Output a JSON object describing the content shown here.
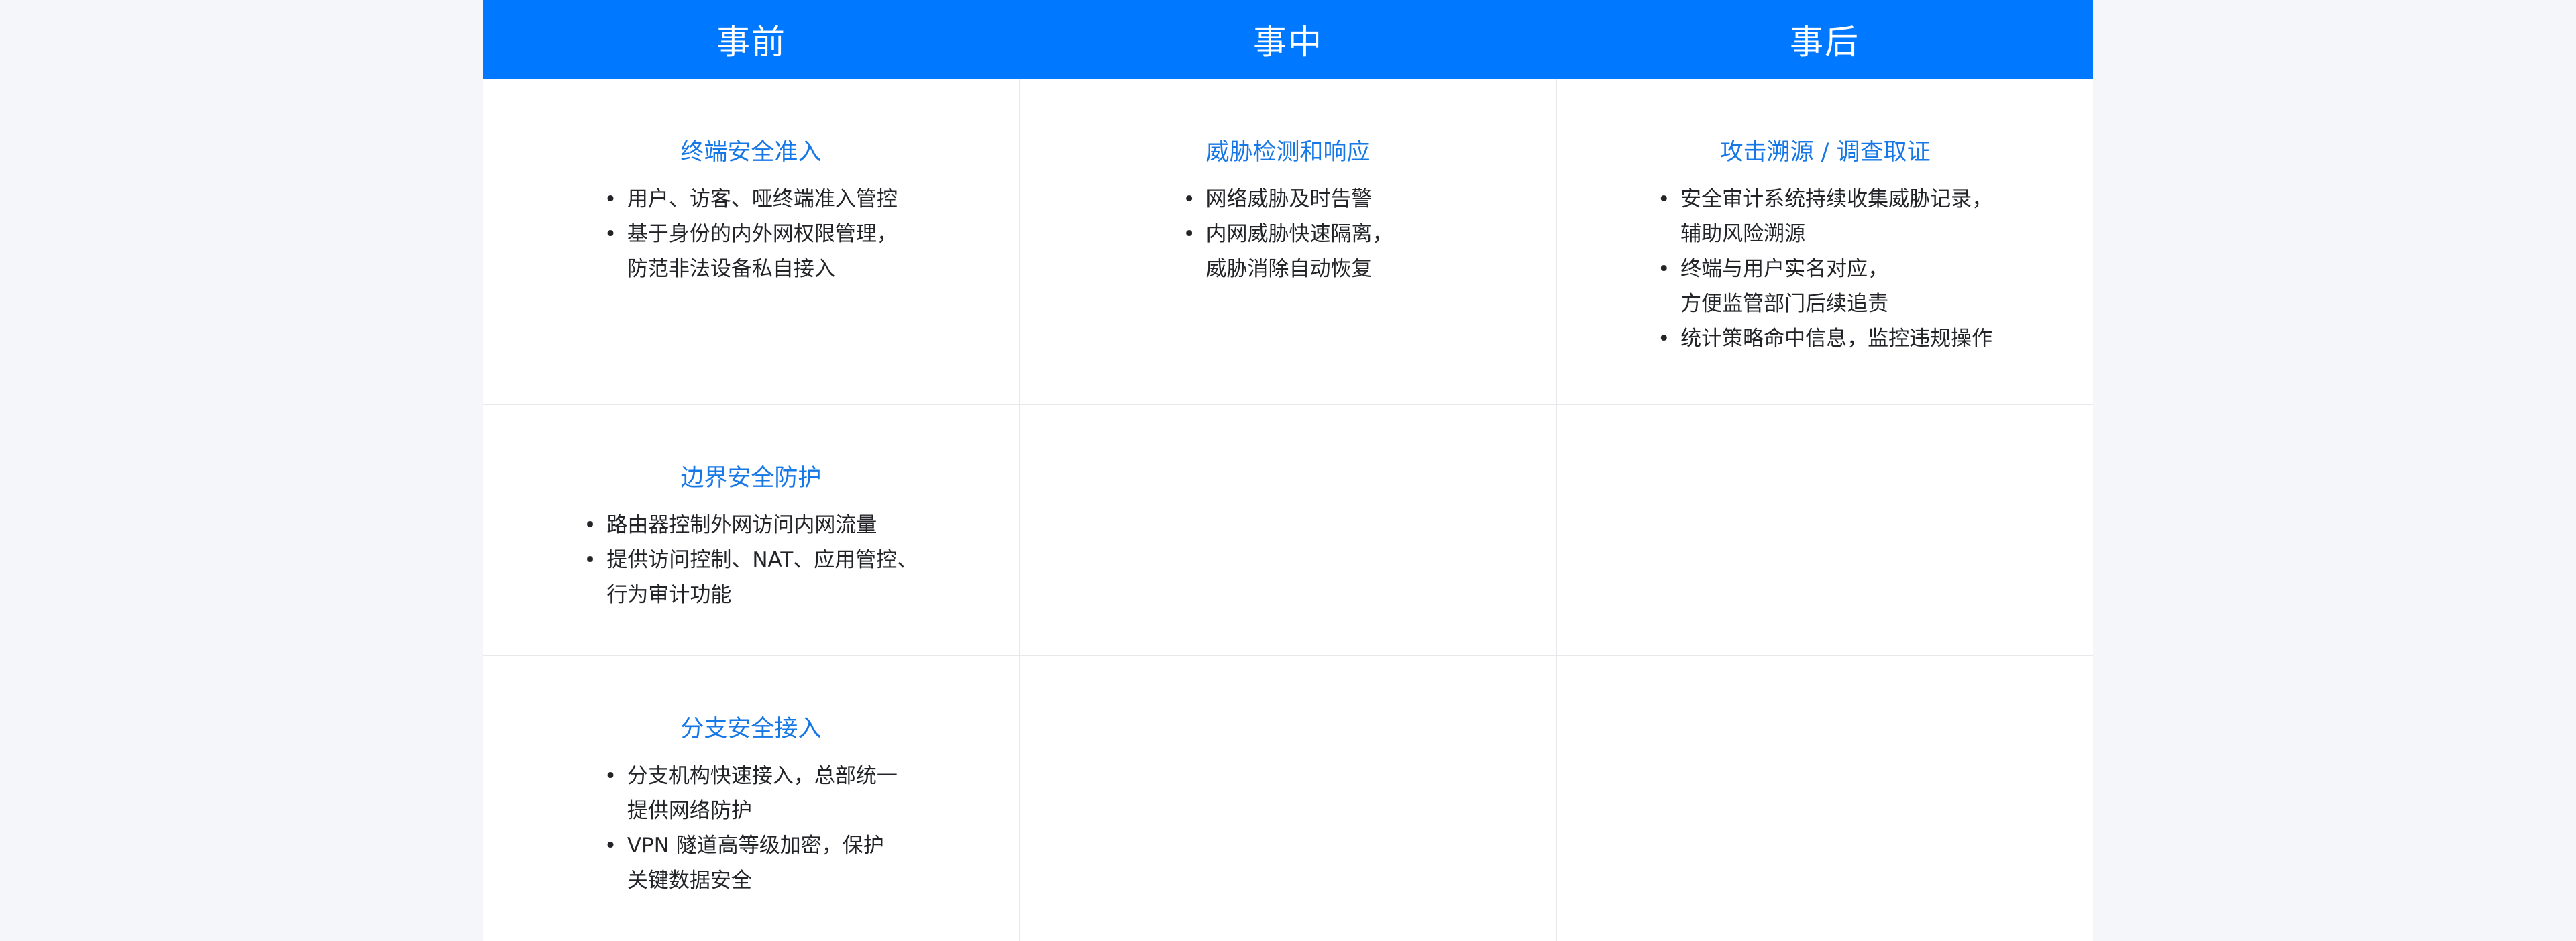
{
  "header": {
    "before": "事前",
    "during": "事中",
    "after": "事后"
  },
  "rows": [
    {
      "before": {
        "title": "终端安全准入",
        "items": [
          "用户、访客、哑终端准入管控",
          "基于身份的内外网权限管理，\n防范非法设备私自接入"
        ]
      },
      "during": {
        "title": "威胁检测和响应",
        "items": [
          "网络威胁及时告警",
          "内网威胁快速隔离，\n威胁消除自动恢复"
        ]
      },
      "after": {
        "title": "攻击溯源 / 调查取证",
        "items": [
          "安全审计系统持续收集威胁记录，\n辅助风险溯源",
          "终端与用户实名对应，\n方便监管部门后续追责",
          "统计策略命中信息，监控违规操作"
        ]
      }
    },
    {
      "before": {
        "title": "边界安全防护",
        "items": [
          "路由器控制外网访问内网流量",
          "提供访问控制、NAT、应用管控、\n行为审计功能"
        ]
      }
    },
    {
      "before": {
        "title": "分支安全接入",
        "items": [
          "分支机构快速接入，总部统一\n提供网络防护",
          "VPN 隧道高等级加密，保护\n关键数据安全"
        ]
      }
    }
  ],
  "bullet": "•"
}
